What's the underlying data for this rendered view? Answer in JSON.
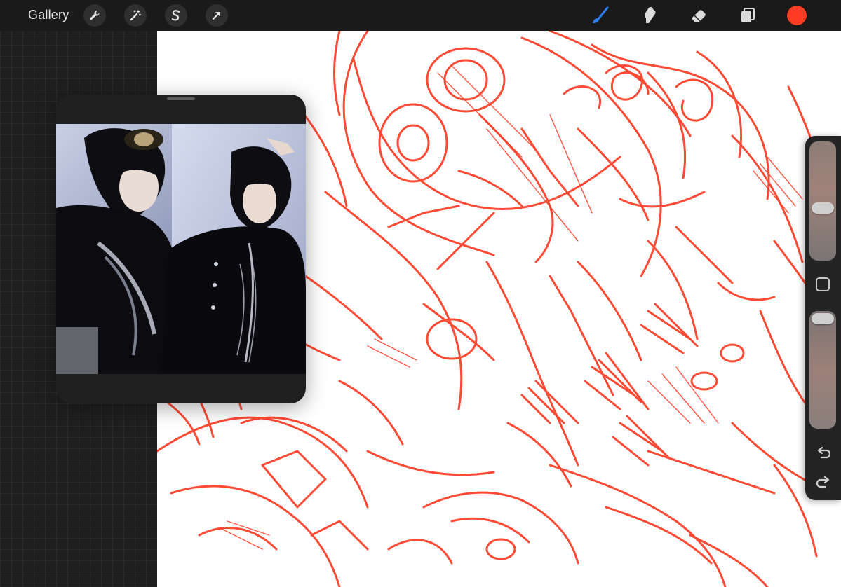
{
  "toolbar": {
    "gallery_label": "Gallery",
    "left_tools": [
      "wrench-icon",
      "magic-wand-icon",
      "selection-icon",
      "transform-arrow-icon"
    ],
    "right_tools": [
      "brush-icon",
      "smudge-icon",
      "eraser-icon",
      "layers-icon"
    ],
    "active_tool": "brush-icon",
    "active_color": "#ff3b24",
    "brush_active_color": "#2f7df6"
  },
  "sidebar": {
    "brush_size_level": 0.45,
    "opacity_level": 0.95,
    "controls": [
      "brush-size-slider",
      "modify-button",
      "opacity-slider",
      "undo-icon",
      "redo-icon"
    ]
  },
  "reference": {
    "window": "reference-window",
    "content": "reference-photo"
  },
  "canvas": {
    "stroke_color": "#ff3b24"
  }
}
